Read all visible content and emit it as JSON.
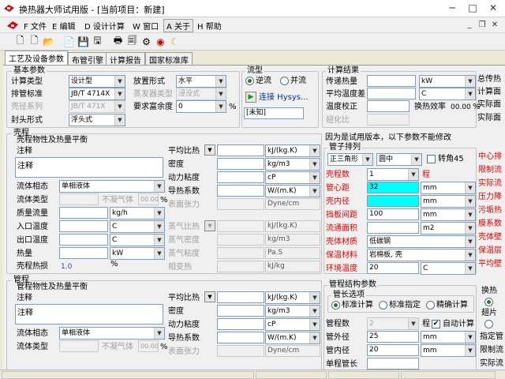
{
  "window": {
    "title": "换热器大师试用版 - [当前项目：新建]",
    "minimize": "─",
    "maximize": "□",
    "close": "✕"
  },
  "menu": {
    "file": "F 文件",
    "edit": "E 编辑",
    "design": "D 设计计算",
    "window": "W 窗口",
    "about": "A 关于",
    "help": "H 帮助"
  },
  "tabs": [
    "工艺及设备参数",
    "布管引擎",
    "计算报告",
    "国家标准库"
  ],
  "basic": {
    "title": "基本参数",
    "calc_type_label": "计算类型",
    "calc_type_value": "设计型",
    "standard_label": "排管标准",
    "standard_value": "JB/T 4714X",
    "shell_series_label": "壳径系列",
    "shell_series_value": "JB/T 471X",
    "head_label": "封头形式",
    "head_value": "浮头式",
    "orientation_label": "放置形式",
    "orientation_value": "水平",
    "evap_label": "蒸发器类型",
    "evap_value": "浸没式",
    "margin_label": "要求富余度",
    "margin_value": "0",
    "margin_unit": "%"
  },
  "flow": {
    "title": "流型",
    "counter": "逆流",
    "parallel": "并流",
    "connect": "连接 Hysys...",
    "unknown": "[未知]"
  },
  "result": {
    "title": "计算结果",
    "heat_label": "传递热量",
    "heat_unit": "kW",
    "avg_temp_label": "平均温度差",
    "avg_temp_unit": "C",
    "temp_corr_label": "温度校正",
    "eff_label": "换热效率",
    "eff_value": "00.00",
    "eff_unit": "%",
    "fouling_label": "翅化比",
    "total_heat_label": "总传热",
    "calc_area_label": "计算面",
    "actual_area_label": "实际面",
    "actual_area2_label": "实际面"
  },
  "shell": {
    "title": "壳程",
    "props_title": "壳程物性及热量平衡",
    "note_label": "注释",
    "note_value": "注释",
    "phase_label": "流体相态",
    "phase_value": "单相液体",
    "fluid_type_label": "流体类型",
    "noncond_label": "不凝气体",
    "noncond_value": "00.00",
    "noncond_unit": "%",
    "mass_flow_label": "质量流量",
    "mass_flow_unit": "kg/h",
    "inlet_label": "入口温度",
    "inlet_unit": "C",
    "outlet_label": "出口温度",
    "outlet_unit": "C",
    "heat_label": "热量",
    "heat_unit": "kW",
    "loss_label": "壳程热损",
    "loss_value": "1.0",
    "loss_unit": "%",
    "cp_label": "平均比热",
    "cp_unit": "kJ/(kg.K)",
    "density_label": "密度",
    "density_unit": "kg/m3",
    "visc_label": "动力粘度",
    "visc_unit": "cP",
    "cond_label": "导热系数",
    "cond_unit": "W/(m.K)",
    "tension_label": "表面张力",
    "tension_unit": "Dyne/cm",
    "vcp_label": "蒸气比热",
    "vcp_unit": "kJ/(kg.K)",
    "vdens_label": "蒸气密度",
    "vdens_unit": "kg/m3",
    "vvisc_label": "蒸气粘度",
    "vvisc_unit": "Pa.S",
    "latent_label": "相变热",
    "latent_unit": "kJ/kg"
  },
  "trial_note": "因为是试用版本，以下参数不能修改",
  "layout": {
    "title": "管子排列",
    "pattern_value": "正三角形",
    "pattern2_value": "圆中",
    "rotate_label": "转角45",
    "shell_count_label": "壳程数",
    "shell_count_value": "1",
    "shell_count_suffix": "程",
    "tube_od_label": "管心距",
    "tube_od_value": "32",
    "tube_od_unit": "mm",
    "shell_id_label": "壳内径",
    "shell_id_unit": "mm",
    "baffle_label": "挡板间距",
    "baffle_value": "100",
    "baffle_unit": "mm",
    "flow_area_label": "流通面积",
    "flow_area_unit": "m2",
    "shell_mat_label": "壳体材质",
    "shell_mat_value": "低碳钢",
    "insul_label": "保温材料",
    "insul_value": "岩棉板, 壳",
    "ambient_label": "环境温度",
    "ambient_value": "20",
    "ambient_unit": "C"
  },
  "right_red": [
    "中心排",
    "限制流",
    "实际流",
    "压力降",
    "污垢热",
    "膜系数",
    "壳体壁",
    "保温层",
    "平均壁"
  ],
  "tube": {
    "title": "管程",
    "props_title": "管程物性及热量平衡",
    "note_label": "注释",
    "note_value": "注释",
    "phase_label": "流体相态",
    "phase_value": "单相液体",
    "fluid_type_label": "流体类型",
    "noncond_label": "不凝气体",
    "noncond_value": "00.00",
    "noncond_unit": "%",
    "cp_label": "平均比热",
    "cp_unit": "kJ/(kg.K)",
    "density_label": "密度",
    "density_unit": "kg/m3",
    "visc_label": "动力粘度",
    "visc_unit": "cP",
    "cond_label": "导热系数",
    "cond_unit": "W/(m.K)",
    "tension_label": "表面张力",
    "tension_unit": "Dyne/cm"
  },
  "struct": {
    "title": "管程结构参数",
    "len_opt_title": "管长选项",
    "std_calc": "标准计算",
    "std_spec": "标准指定",
    "precise": "精确计算",
    "tube_count_label": "管程数",
    "tube_count_value": "2",
    "tube_count_suffix": "程",
    "auto_calc": "自动计算",
    "od_label": "管外径",
    "od_value": "25",
    "od_unit": "mm",
    "id_label": "管内径",
    "id_value": "20",
    "id_unit": "mm",
    "extra_label": "单程管长"
  },
  "right_lower": {
    "exchanger": "换热",
    "fin_ratio": "翅片",
    "specified": "指定管",
    "limit": "限制流",
    "actual": "实际流"
  }
}
